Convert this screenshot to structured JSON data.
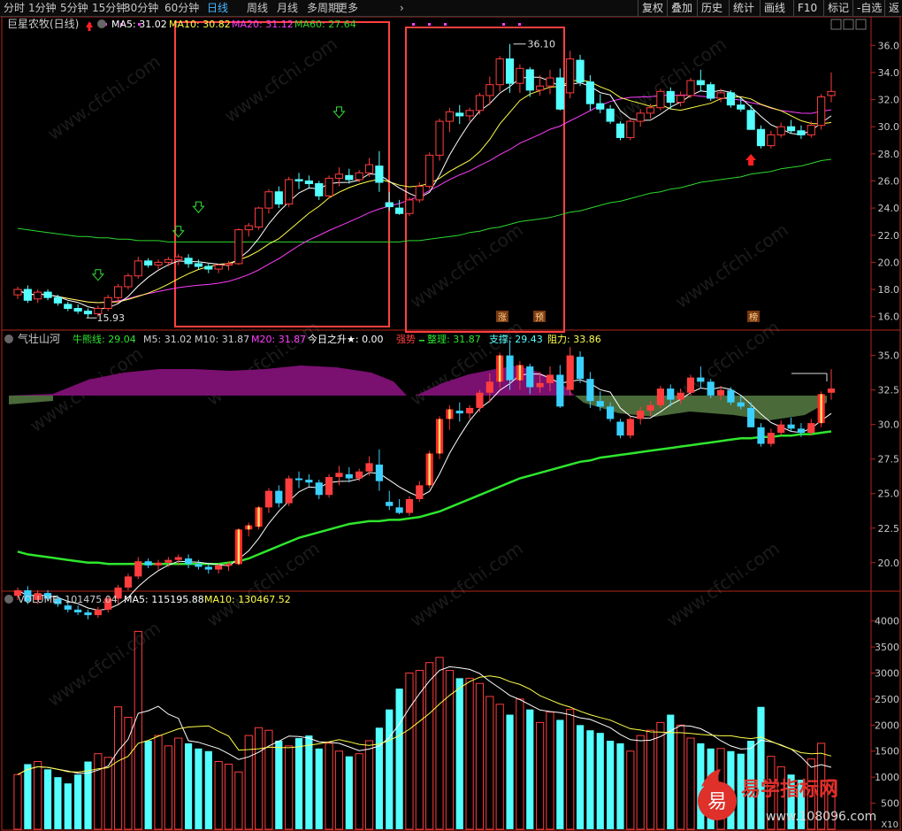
{
  "toolbar": {
    "periods": [
      "分时",
      "1分钟",
      "5分钟",
      "15分钟",
      "30分钟",
      "60分钟",
      "日线",
      "周线",
      "月线",
      "多周期",
      "更多"
    ],
    "active_period": "日线",
    "right": [
      "复权",
      "叠加",
      "历史",
      "统计",
      "画线",
      "F10",
      "标记",
      "-自选",
      "返"
    ]
  },
  "colors": {
    "up": "#ff3d3d",
    "down": "#54ffff",
    "ma5": "#ffffff",
    "ma10": "#ffff4a",
    "ma20": "#ff3cff",
    "ma60": "#2ed82e",
    "border": "#b4261c",
    "highlight_box": "#ff4040",
    "purple_fill": "#7a1070",
    "olive_fill": "#4a6a3a",
    "support_line": "#2ee62e",
    "volume_up": "#ff3d3d",
    "volume_down": "#54ffff"
  },
  "main_panel": {
    "title": "巨星农牧(日线)",
    "ma5": "MA5: 31.02",
    "ma10": "MA10: 30.82",
    "ma20": "MA20: 31.12",
    "ma60": "MA60: 27.64",
    "y_ticks": [
      "36.0",
      "34.0",
      "32.0",
      "30.0",
      "28.0",
      "26.0",
      "24.0",
      "22.0",
      "20.0",
      "18.0",
      "16.0"
    ],
    "high_label": "36.10",
    "low_label": "15.93",
    "markers": [
      "涨",
      "预",
      "榜"
    ]
  },
  "indicator_panel": {
    "title": "气壮山河",
    "items": [
      "牛熊线: 29.04",
      "M5: 31.02",
      "M10: 31.87",
      "M20: 31.87",
      "今日之升★: 0.00",
      "强势",
      "整理: 31.87",
      "支撑: 29.43",
      "阻力: 33.86"
    ],
    "y_ticks": [
      "35.0",
      "32.5",
      "30.0",
      "27.5",
      "25.0",
      "22.5",
      "20.0"
    ]
  },
  "volume_panel": {
    "title": "VOLUME: 101475.04",
    "ma5": "MA5: 115195.88",
    "ma10": "MA10: 130467.52",
    "y_ticks": [
      "4000",
      "3500",
      "3000",
      "2500",
      "2000",
      "1500",
      "1000",
      "500"
    ],
    "unit": "X10"
  },
  "watermarks": {
    "site": "www.cfchi.com",
    "brand": "易学指标网",
    "brand_url": "www.108096.com",
    "brand_glyph": "易"
  },
  "chart_data": {
    "type": "candlestick",
    "title": "巨星农牧(日线)",
    "price_range": [
      15.0,
      36.8
    ],
    "indicator_range": [
      18.0,
      36.0
    ],
    "volume_range": [
      0,
      4300
    ],
    "ohlc": [
      [
        17.6,
        18.2,
        17.3,
        18.0
      ],
      [
        18.0,
        18.3,
        17.0,
        17.2
      ],
      [
        17.3,
        18.0,
        17.0,
        17.8
      ],
      [
        17.8,
        18.0,
        17.2,
        17.4
      ],
      [
        17.4,
        17.6,
        16.8,
        17.0
      ],
      [
        16.9,
        17.1,
        16.4,
        16.6
      ],
      [
        16.6,
        16.9,
        16.2,
        16.4
      ],
      [
        16.4,
        16.6,
        15.9,
        16.2
      ],
      [
        16.2,
        16.8,
        16.0,
        16.6
      ],
      [
        16.6,
        17.6,
        16.4,
        17.4
      ],
      [
        17.4,
        18.4,
        17.0,
        18.2
      ],
      [
        18.2,
        19.2,
        18.0,
        19.0
      ],
      [
        19.0,
        20.4,
        18.8,
        20.1
      ],
      [
        20.1,
        20.3,
        19.6,
        19.8
      ],
      [
        19.8,
        20.2,
        19.5,
        20.0
      ],
      [
        20.0,
        20.4,
        19.7,
        20.2
      ],
      [
        20.2,
        20.6,
        19.8,
        20.4
      ],
      [
        20.3,
        20.6,
        19.6,
        19.9
      ],
      [
        19.9,
        20.2,
        19.5,
        19.7
      ],
      [
        19.7,
        19.9,
        19.2,
        19.5
      ],
      [
        19.5,
        19.9,
        19.2,
        19.8
      ],
      [
        19.8,
        20.1,
        19.4,
        19.9
      ],
      [
        19.9,
        22.5,
        19.8,
        22.4
      ],
      [
        22.4,
        22.9,
        21.9,
        22.7
      ],
      [
        22.6,
        24.1,
        22.4,
        24.0
      ],
      [
        24.0,
        25.4,
        23.6,
        25.2
      ],
      [
        25.2,
        25.6,
        24.0,
        24.3
      ],
      [
        24.3,
        26.3,
        24.1,
        26.1
      ],
      [
        26.1,
        26.6,
        25.4,
        26.0
      ],
      [
        26.0,
        26.4,
        25.5,
        25.8
      ],
      [
        25.8,
        26.0,
        24.6,
        24.9
      ],
      [
        24.9,
        26.4,
        24.7,
        26.2
      ],
      [
        26.2,
        27.0,
        25.6,
        26.5
      ],
      [
        26.4,
        26.9,
        25.8,
        26.1
      ],
      [
        26.1,
        26.8,
        25.9,
        26.6
      ],
      [
        26.6,
        27.7,
        26.3,
        27.2
      ],
      [
        27.1,
        28.2,
        25.2,
        25.9
      ],
      [
        24.4,
        25.2,
        23.8,
        24.1
      ],
      [
        24.0,
        24.6,
        23.5,
        23.6
      ],
      [
        23.6,
        24.8,
        23.4,
        24.6
      ],
      [
        24.6,
        25.9,
        24.4,
        25.6
      ],
      [
        25.6,
        28.1,
        25.4,
        27.9
      ],
      [
        27.9,
        30.6,
        27.5,
        30.4
      ],
      [
        30.4,
        31.4,
        29.6,
        31.1
      ],
      [
        31.0,
        31.6,
        30.2,
        30.8
      ],
      [
        30.8,
        31.4,
        30.4,
        31.2
      ],
      [
        31.2,
        32.5,
        30.9,
        32.3
      ],
      [
        32.3,
        33.7,
        31.6,
        33.1
      ],
      [
        33.1,
        35.2,
        32.6,
        35.0
      ],
      [
        35.0,
        36.1,
        32.5,
        33.2
      ],
      [
        33.2,
        34.6,
        32.5,
        34.3
      ],
      [
        34.2,
        34.4,
        32.2,
        32.7
      ],
      [
        32.7,
        33.8,
        32.3,
        33.0
      ],
      [
        33.0,
        34.2,
        32.4,
        33.6
      ],
      [
        33.6,
        34.3,
        31.2,
        31.3
      ],
      [
        32.5,
        35.6,
        32.1,
        35.0
      ],
      [
        34.9,
        35.3,
        33.0,
        33.3
      ],
      [
        33.3,
        33.8,
        31.2,
        31.7
      ],
      [
        31.7,
        32.4,
        31.0,
        31.3
      ],
      [
        31.3,
        31.6,
        30.2,
        30.4
      ],
      [
        30.2,
        30.4,
        29.0,
        29.2
      ],
      [
        29.2,
        30.6,
        29.0,
        30.4
      ],
      [
        30.4,
        31.3,
        30.0,
        31.0
      ],
      [
        31.0,
        31.7,
        30.6,
        31.4
      ],
      [
        31.4,
        32.8,
        31.2,
        32.6
      ],
      [
        32.6,
        32.9,
        31.3,
        31.8
      ],
      [
        31.8,
        32.6,
        31.5,
        32.3
      ],
      [
        32.3,
        33.6,
        32.1,
        33.4
      ],
      [
        33.4,
        34.2,
        32.6,
        33.1
      ],
      [
        33.1,
        33.3,
        31.9,
        32.1
      ],
      [
        32.1,
        32.8,
        31.8,
        32.5
      ],
      [
        32.5,
        32.7,
        31.4,
        31.6
      ],
      [
        31.6,
        32.1,
        31.1,
        31.3
      ],
      [
        31.2,
        31.6,
        29.8,
        29.8
      ],
      [
        29.8,
        30.1,
        28.4,
        28.6
      ],
      [
        28.6,
        29.7,
        28.4,
        29.4
      ],
      [
        29.4,
        30.3,
        29.2,
        30.0
      ],
      [
        30.0,
        30.5,
        29.5,
        29.7
      ],
      [
        29.7,
        30.1,
        29.1,
        29.4
      ],
      [
        29.4,
        30.4,
        29.2,
        30.1
      ],
      [
        30.1,
        32.4,
        29.8,
        32.2
      ],
      [
        32.3,
        34.0,
        31.8,
        32.6
      ]
    ],
    "ma60": [
      22.5,
      22.4,
      22.3,
      22.2,
      22.1,
      22.0,
      21.9,
      21.9,
      21.8,
      21.8,
      21.7,
      21.7,
      21.6,
      21.6,
      21.6,
      21.5,
      21.5,
      21.5,
      21.5,
      21.5,
      21.5,
      21.5,
      21.5,
      21.5,
      21.5,
      21.5,
      21.5,
      21.5,
      21.5,
      21.5,
      21.5,
      21.5,
      21.5,
      21.5,
      21.5,
      21.5,
      21.5,
      21.5,
      21.5,
      21.6,
      21.6,
      21.7,
      21.8,
      21.9,
      22.0,
      22.2,
      22.3,
      22.5,
      22.6,
      22.8,
      23.0,
      23.1,
      23.2,
      23.3,
      23.5,
      23.7,
      23.8,
      24.0,
      24.2,
      24.4,
      24.5,
      24.7,
      24.9,
      25.1,
      25.2,
      25.4,
      25.5,
      25.7,
      25.9,
      26.0,
      26.1,
      26.2,
      26.3,
      26.5,
      26.6,
      26.7,
      26.9,
      27.0,
      27.1,
      27.3,
      27.5,
      27.6
    ],
    "volume": [
      1050,
      1250,
      1300,
      1150,
      1000,
      880,
      1050,
      1300,
      1450,
      1380,
      2350,
      2150,
      3800,
      1700,
      1800,
      1600,
      1750,
      1650,
      1550,
      1500,
      1300,
      1250,
      1100,
      1800,
      1950,
      1900,
      1700,
      1600,
      1750,
      1800,
      1550,
      1650,
      1500,
      1400,
      1450,
      1700,
      1950,
      2300,
      2700,
      3000,
      3050,
      3200,
      3300,
      3050,
      2900,
      2900,
      2800,
      2550,
      2400,
      2200,
      2500,
      2300,
      2050,
      2250,
      2100,
      2300,
      2000,
      1900,
      1850,
      1700,
      1650,
      1500,
      1800,
      1900,
      2050,
      2200,
      2000,
      1750,
      1650,
      1550,
      1550,
      1500,
      1450,
      1700,
      2350,
      1400,
      1200,
      1050,
      950,
      1350,
      1650,
      950
    ]
  }
}
